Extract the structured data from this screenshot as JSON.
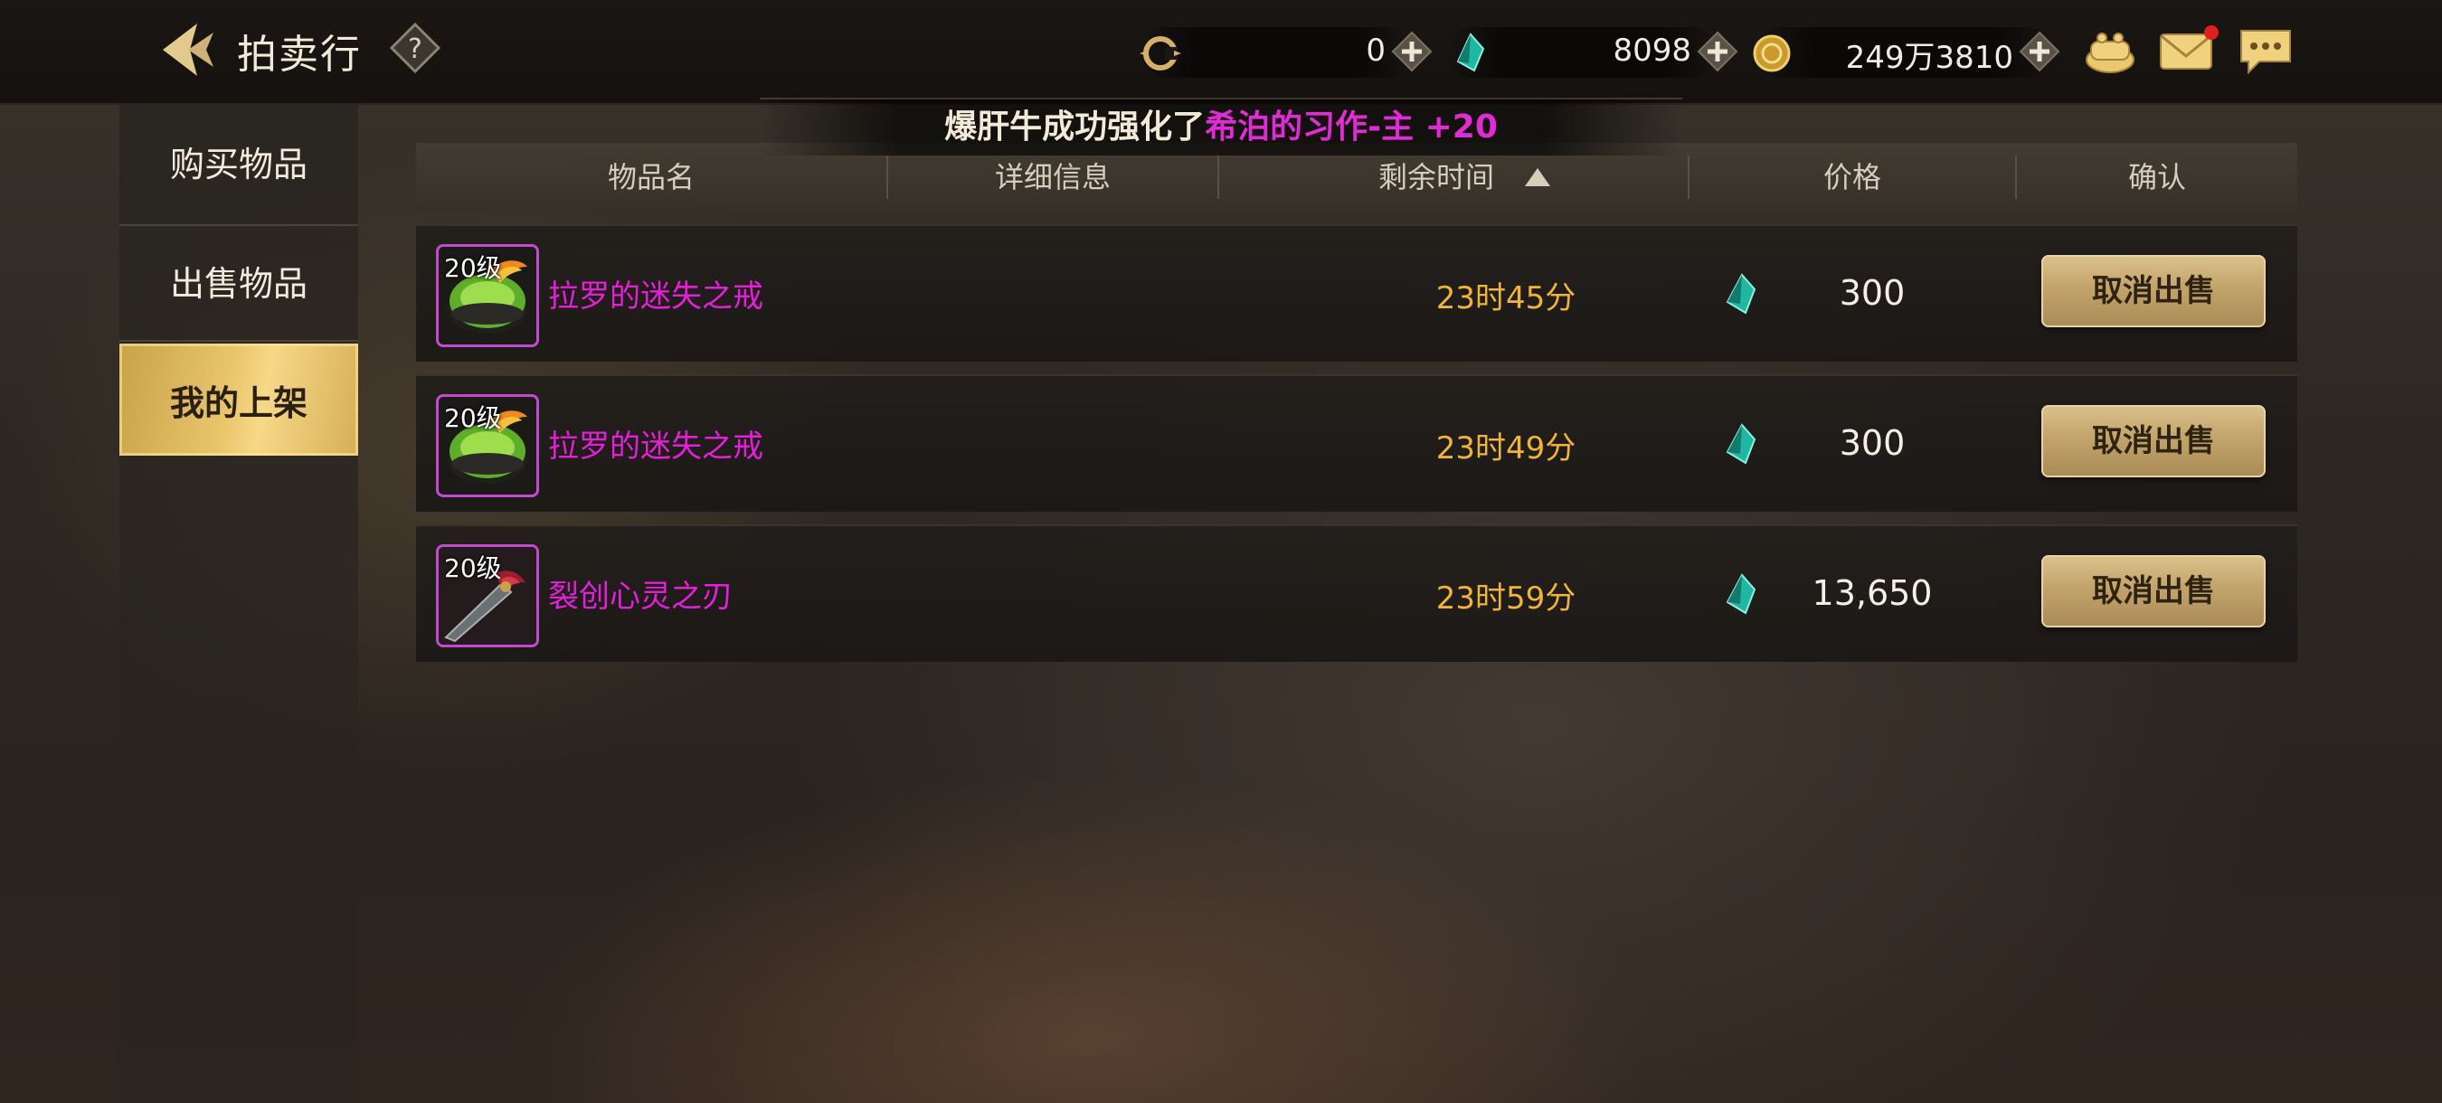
{
  "header": {
    "title": "拍卖行",
    "back_icon": "back-arrow-icon",
    "help_icon": "question-icon"
  },
  "currencies": [
    {
      "icon": "gold-c-icon",
      "value": "0"
    },
    {
      "icon": "teal-gem-icon",
      "value": "8098"
    },
    {
      "icon": "gold-coin-icon",
      "value": "249万3810"
    }
  ],
  "top_icons": [
    "bag-icon",
    "mail-icon",
    "chat-icon"
  ],
  "sidebar": {
    "items": [
      {
        "label": "购买物品",
        "active": false
      },
      {
        "label": "出售物品",
        "active": false
      },
      {
        "label": "我的上架",
        "active": true
      }
    ]
  },
  "notice": {
    "prefix": "爆肝牛成功强化了",
    "highlight": "希泊的习作-主 +20"
  },
  "table": {
    "headers": [
      "物品名",
      "详细信息",
      "剩余时间",
      "价格",
      "确认"
    ],
    "rows": [
      {
        "level": "20级",
        "name": "拉罗的迷失之戒",
        "time": "23时45分",
        "price": "300",
        "action": "取消出售",
        "icon": "green-ring-icon"
      },
      {
        "level": "20级",
        "name": "拉罗的迷失之戒",
        "time": "23时49分",
        "price": "300",
        "action": "取消出售",
        "icon": "green-ring-icon"
      },
      {
        "level": "20级",
        "name": "裂创心灵之刃",
        "time": "23时59分",
        "price": "13,650",
        "action": "取消出售",
        "icon": "blade-icon"
      }
    ]
  },
  "colors": {
    "accent_gold": "#e8c56a",
    "item_name": "#e51fd9",
    "time_text": "#f0b62d",
    "notice_highlight": "#e22ad6"
  }
}
